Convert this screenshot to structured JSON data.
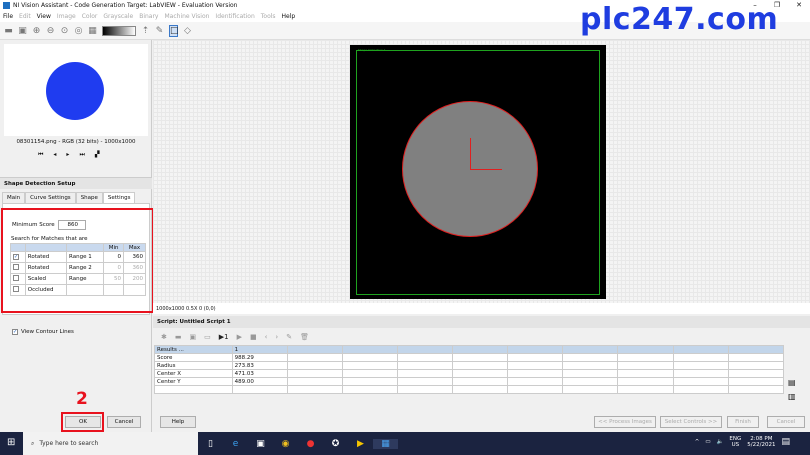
{
  "window": {
    "title": "NI Vision Assistant - Code Generation Target: LabVIEW - Evaluation Version",
    "minimize": "–",
    "maximize": "❐",
    "close": "✕"
  },
  "menu": [
    "File",
    "Edit",
    "View",
    "Image",
    "Color",
    "Grayscale",
    "Binary",
    "Machine Vision",
    "Identification",
    "Tools",
    "Help"
  ],
  "watermark": "plc247.com",
  "thumbnail": {
    "caption": "08301154.png - RGB (32 bits) - 1000x1000"
  },
  "setup": {
    "header": "Shape Detection Setup",
    "tabs": [
      "Main",
      "Curve Settings",
      "Shape",
      "Settings"
    ],
    "active_tab": "Settings",
    "min_score_label": "Minimum Score",
    "min_score": "860",
    "search_label": "Search for Matches that are",
    "col_min": "Min",
    "col_max": "Max",
    "rows": [
      {
        "checked": true,
        "name": "Rotated",
        "range": "Range 1",
        "min": "0",
        "max": "360",
        "enabled": true
      },
      {
        "checked": false,
        "name": "Rotated",
        "range": "Range 2",
        "min": "0",
        "max": "360",
        "enabled": false
      },
      {
        "checked": false,
        "name": "Scaled",
        "range": "Range",
        "min": "50",
        "max": "200",
        "enabled": false
      },
      {
        "checked": false,
        "name": "Occluded",
        "range": "",
        "min": "",
        "max": "",
        "enabled": false
      }
    ],
    "view_contour": "View Contour Lines",
    "view_contour_checked": true
  },
  "annotations": {
    "one": "1",
    "two": "2"
  },
  "buttons": {
    "ok": "OK",
    "cancel": "Cancel",
    "help": "Help",
    "process": "<< Process Images",
    "select": "Select Controls >>",
    "finish": "Finish",
    "cancel2": "Cancel"
  },
  "image": {
    "roi_label": "Shape Detection 1",
    "status": "1000x1000 0.5X 0   (0,0)"
  },
  "script": {
    "title": "Script: Untitled Script 1",
    "results": {
      "header": [
        "Results ...",
        "1"
      ],
      "rows": [
        [
          "Score",
          "988.29"
        ],
        [
          "Radius",
          "273.83"
        ],
        [
          "Center X",
          "471.03"
        ],
        [
          "Center Y",
          "489.00"
        ]
      ]
    }
  },
  "taskbar": {
    "search": "Type here to search",
    "lang": "ENG",
    "region": "US",
    "time": "2:08 PM",
    "date": "5/22/2021"
  }
}
